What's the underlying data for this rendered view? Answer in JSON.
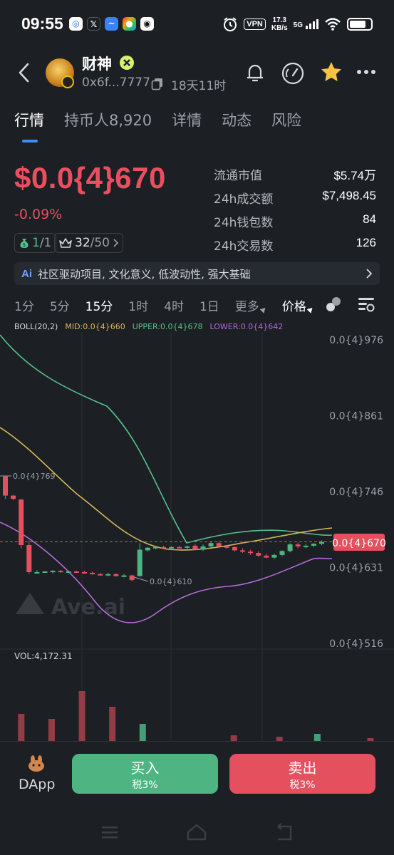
{
  "status_bar": {
    "time": "09:55",
    "vpn": "VPN",
    "speed_value": "17.3",
    "speed_unit": "KB/s",
    "network": "5G",
    "battery_level": 0.8,
    "app_icons": [
      "app-icon-a",
      "x-icon",
      "app-icon-wave",
      "app-icon-color",
      "app-icon-penguin"
    ]
  },
  "header": {
    "token_name": "财神",
    "address": "0x6f...7777",
    "age": "18天11时"
  },
  "tabs": [
    {
      "label": "行情",
      "active": true
    },
    {
      "label": "持币人8,920",
      "active": false
    },
    {
      "label": "详情",
      "active": false
    },
    {
      "label": "动态",
      "active": false
    },
    {
      "label": "风险",
      "active": false
    }
  ],
  "price": {
    "value": "$0.0{4}670",
    "change": "-0.09%",
    "chip1_a": "1",
    "chip1_b": "/1",
    "chip2_a": "32",
    "chip2_b": "/50"
  },
  "stats": [
    {
      "label": "流通市值",
      "value": "$5.74万"
    },
    {
      "label": "24h成交额",
      "value": "$7,498.45"
    },
    {
      "label": "24h钱包数",
      "value": "84"
    },
    {
      "label": "24h交易数",
      "value": "126"
    }
  ],
  "tagline": {
    "ai": "Ai",
    "text": "社区驱动项目, 文化意义, 低波动性, 强大基础"
  },
  "intervals": [
    "1分",
    "5分",
    "15分",
    "1时",
    "4时",
    "1日"
  ],
  "active_interval": "15分",
  "more_label": "更多",
  "price_type_label": "价格",
  "boll": {
    "label": "BOLL(20,2)",
    "mid": "MID:0.0{4}660",
    "upper": "UPPER:0.0{4}678",
    "lower": "LOWER:0.0{4}642",
    "mid_color": "#d6b85a",
    "upper_color": "#58c08c",
    "lower_color": "#b56ad9"
  },
  "chart_data": {
    "type": "candlestick",
    "y_tick_labels": [
      "0.0{4}976",
      "0.0{4}861",
      "0.0{4}746",
      "0.0{4}631",
      "0.0{4}516"
    ],
    "ylim": [
      5.16e-05,
      9.76e-05
    ],
    "current_price_label": "0.0{4}670",
    "current_price": 6.7e-05,
    "high_annotation": "0.0{4}769",
    "low_annotation": "0.0{4}610",
    "watermark": "Ave.ai",
    "up_color": "#4eb582",
    "down_color": "#e5505e",
    "candles": [
      [
        769,
        769,
        735,
        740
      ],
      [
        740,
        741,
        733,
        735
      ],
      [
        734,
        735,
        660,
        665
      ],
      [
        665,
        672,
        621,
        624
      ],
      [
        624,
        627,
        622,
        624
      ],
      [
        624,
        626,
        623,
        625
      ],
      [
        624,
        627,
        622,
        626
      ],
      [
        626,
        627,
        623,
        624
      ],
      [
        624,
        626,
        623,
        625
      ],
      [
        625,
        626,
        623,
        624
      ],
      [
        624,
        626,
        622,
        623
      ],
      [
        623,
        625,
        620,
        621
      ],
      [
        621,
        623,
        619,
        620
      ],
      [
        620,
        623,
        618,
        621
      ],
      [
        621,
        622,
        617,
        618
      ],
      [
        618,
        621,
        616,
        619
      ],
      [
        619,
        620,
        610,
        612
      ],
      [
        618,
        668,
        617,
        658
      ],
      [
        657,
        662,
        655,
        661
      ],
      [
        661,
        664,
        659,
        662
      ],
      [
        662,
        664,
        660,
        661
      ],
      [
        661,
        663,
        658,
        662
      ],
      [
        662,
        664,
        660,
        661
      ],
      [
        661,
        664,
        659,
        663
      ],
      [
        664,
        667,
        662,
        658
      ],
      [
        658,
        666,
        656,
        663
      ],
      [
        663,
        671,
        661,
        668
      ],
      [
        668,
        670,
        661,
        663
      ],
      [
        663,
        665,
        659,
        662
      ],
      [
        662,
        663,
        655,
        657
      ],
      [
        657,
        660,
        653,
        655
      ],
      [
        655,
        658,
        650,
        653
      ],
      [
        653,
        656,
        647,
        649
      ],
      [
        649,
        652,
        645,
        646
      ],
      [
        646,
        652,
        644,
        650
      ],
      [
        650,
        657,
        648,
        656
      ],
      [
        656,
        668,
        654,
        666
      ],
      [
        666,
        669,
        660,
        663
      ],
      [
        663,
        667,
        660,
        664
      ],
      [
        664,
        668,
        662,
        667
      ],
      [
        667,
        672,
        665,
        670
      ]
    ],
    "volume_label": "VOL:4,172.31",
    "volumes": [
      [
        2,
        38,
        0
      ],
      [
        6,
        31,
        0
      ],
      [
        10,
        70,
        0
      ],
      [
        14,
        48,
        0
      ],
      [
        18,
        24,
        1
      ],
      [
        30,
        8,
        0
      ],
      [
        36,
        6,
        0
      ],
      [
        41,
        10,
        1
      ],
      [
        48,
        4,
        0
      ],
      [
        54,
        108,
        1
      ],
      [
        59,
        8,
        0
      ],
      [
        66,
        4,
        0
      ],
      [
        74,
        10,
        0
      ],
      [
        82,
        2,
        1
      ],
      [
        90,
        6,
        1
      ]
    ]
  },
  "bottom": {
    "dapp_label": "DApp",
    "buy_label": "买入",
    "buy_tax": "税3%",
    "sell_label": "卖出",
    "sell_tax": "税3%"
  }
}
